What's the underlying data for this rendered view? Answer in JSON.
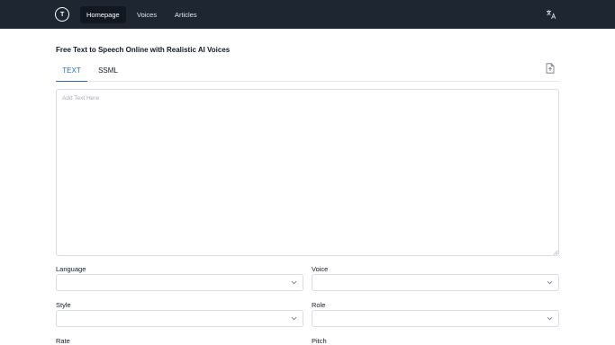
{
  "header": {
    "logo_text": "T",
    "nav": [
      {
        "label": "Homepage",
        "active": true
      },
      {
        "label": "Voices",
        "active": false
      },
      {
        "label": "Articles",
        "active": false
      }
    ]
  },
  "page": {
    "title": "Free Text to Speech Online with Realistic AI Voices"
  },
  "tabs": [
    {
      "label": "TEXT",
      "active": true
    },
    {
      "label": "SSML",
      "active": false
    }
  ],
  "editor": {
    "placeholder": "Add Text Here",
    "value": ""
  },
  "fields": {
    "language": {
      "label": "Language",
      "value": ""
    },
    "voice": {
      "label": "Voice",
      "value": ""
    },
    "style": {
      "label": "Style",
      "value": ""
    },
    "role": {
      "label": "Role",
      "value": ""
    },
    "rate": {
      "label": "Rate"
    },
    "pitch": {
      "label": "Pitch"
    }
  },
  "colors": {
    "header_bg": "#1e2632",
    "accent": "#2b6cb0"
  },
  "icons": [
    "logo-icon",
    "translate-icon",
    "file-upload-icon",
    "chevron-down-icon"
  ]
}
